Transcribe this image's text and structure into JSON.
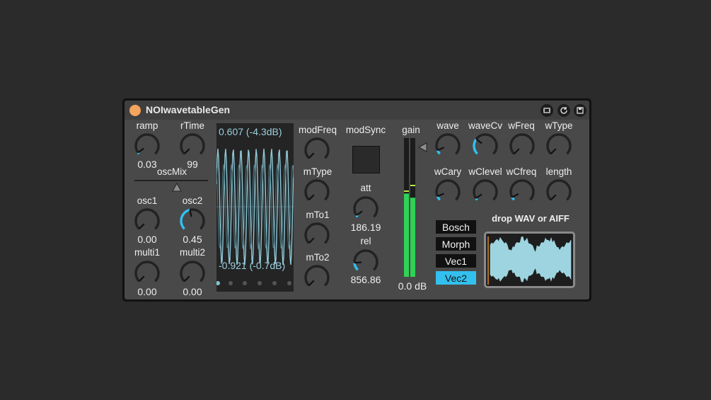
{
  "device": {
    "title": "NOIwavetableGen",
    "icons": [
      "loop-icon",
      "refresh-icon",
      "save-icon"
    ]
  },
  "colors": {
    "accent": "#33c0ef",
    "power": "#f5a45d",
    "meter": "#2fd256",
    "scope_wave": "#8fc8d6"
  },
  "knobs": {
    "ramp": {
      "label": "ramp",
      "value": "0.03",
      "level": 0.03
    },
    "rtime": {
      "label": "rTime",
      "value": "99",
      "level": 0.0
    },
    "osc1": {
      "label": "osc1",
      "value": "0.00",
      "level": 0.0
    },
    "osc2": {
      "label": "osc2",
      "value": "0.45",
      "level": 0.45
    },
    "multi1": {
      "label": "multi1",
      "value": "0.00",
      "level": 0.0
    },
    "multi2": {
      "label": "multi2",
      "value": "0.00",
      "level": 0.0
    },
    "modfreq": {
      "label": "modFreq",
      "level": 0.0
    },
    "mtype": {
      "label": "mType",
      "level": 0.0
    },
    "mto1": {
      "label": "mTo1",
      "level": 0.0
    },
    "mto2": {
      "label": "mTo2",
      "level": 0.0
    },
    "att": {
      "label": "att",
      "value": "186.19",
      "level": 0.04
    },
    "rel": {
      "label": "rel",
      "value": "856.86",
      "level": 0.15
    },
    "wave": {
      "label": "wave",
      "level": 0.08
    },
    "wavecv": {
      "label": "waveCv",
      "level": 0.3
    },
    "wfreq": {
      "label": "wFreq",
      "level": 0.0
    },
    "wtype": {
      "label": "wType",
      "level": 0.0
    },
    "wcary": {
      "label": "wCary",
      "level": 0.08
    },
    "wclevel": {
      "label": "wClevel",
      "level": 0.04
    },
    "wcfreq": {
      "label": "wCfreq",
      "level": 0.06
    },
    "length": {
      "label": "length",
      "level": 0.0
    }
  },
  "oscmix": {
    "label": "oscMix",
    "level": 0.5
  },
  "scope": {
    "top_readout": "0.607 (-4.3dB)",
    "bottom_readout": "-0.921 (-0.7dB)"
  },
  "modsync": {
    "label": "modSync"
  },
  "gain": {
    "label": "gain",
    "value": "0.0 dB",
    "level_left": 0.6,
    "level_right": 0.57
  },
  "buttons": [
    {
      "label": "Bosch",
      "active": false
    },
    {
      "label": "Morph",
      "active": false
    },
    {
      "label": "Vec1",
      "active": false
    },
    {
      "label": "Vec2",
      "active": true
    }
  ],
  "dropzone": {
    "label": "drop WAV or AIFF"
  }
}
